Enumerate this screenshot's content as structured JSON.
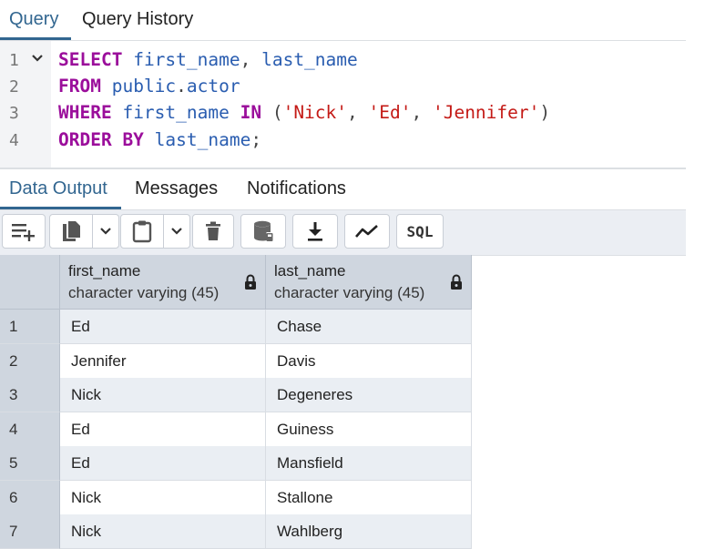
{
  "top_tabs": [
    {
      "label": "Query",
      "active": true
    },
    {
      "label": "Query History",
      "active": false
    }
  ],
  "editor": {
    "line_numbers": [
      "1",
      "2",
      "3",
      "4"
    ],
    "lines": [
      [
        {
          "t": "kw",
          "v": "SELECT"
        },
        {
          "t": "plain",
          "v": " "
        },
        {
          "t": "id",
          "v": "first_name"
        },
        {
          "t": "plain",
          "v": ", "
        },
        {
          "t": "id",
          "v": "last_name"
        }
      ],
      [
        {
          "t": "kw",
          "v": "FROM"
        },
        {
          "t": "plain",
          "v": " "
        },
        {
          "t": "id",
          "v": "public"
        },
        {
          "t": "plain",
          "v": "."
        },
        {
          "t": "id",
          "v": "actor"
        }
      ],
      [
        {
          "t": "kw",
          "v": "WHERE"
        },
        {
          "t": "plain",
          "v": " "
        },
        {
          "t": "id",
          "v": "first_name"
        },
        {
          "t": "plain",
          "v": " "
        },
        {
          "t": "kw",
          "v": "IN"
        },
        {
          "t": "plain",
          "v": " ("
        },
        {
          "t": "str",
          "v": "'Nick'"
        },
        {
          "t": "plain",
          "v": ", "
        },
        {
          "t": "str",
          "v": "'Ed'"
        },
        {
          "t": "plain",
          "v": ", "
        },
        {
          "t": "str",
          "v": "'Jennifer'"
        },
        {
          "t": "plain",
          "v": ")"
        }
      ],
      [
        {
          "t": "kw",
          "v": "ORDER BY"
        },
        {
          "t": "plain",
          "v": " "
        },
        {
          "t": "id",
          "v": "last_name"
        },
        {
          "t": "plain",
          "v": ";"
        }
      ]
    ]
  },
  "output_tabs": [
    {
      "label": "Data Output",
      "active": true
    },
    {
      "label": "Messages",
      "active": false
    },
    {
      "label": "Notifications",
      "active": false
    }
  ],
  "toolbar": {
    "sql_label": "SQL",
    "icons": [
      "add-row-icon",
      "copy-icon",
      "chevron-down-icon",
      "paste-icon",
      "chevron-down-icon",
      "delete-icon",
      "save-data-icon",
      "download-icon",
      "graph-icon",
      "sql-icon"
    ]
  },
  "grid": {
    "columns": [
      {
        "name": "first_name",
        "type": "character varying (45)"
      },
      {
        "name": "last_name",
        "type": "character varying (45)"
      }
    ],
    "rows": [
      [
        "1",
        "Ed",
        "Chase"
      ],
      [
        "2",
        "Jennifer",
        "Davis"
      ],
      [
        "3",
        "Nick",
        "Degeneres"
      ],
      [
        "4",
        "Ed",
        "Guiness"
      ],
      [
        "5",
        "Ed",
        "Mansfield"
      ],
      [
        "6",
        "Nick",
        "Stallone"
      ],
      [
        "7",
        "Nick",
        "Wahlberg"
      ]
    ]
  },
  "colors": {
    "accent": "#326690",
    "keyword": "#9b0e9b",
    "identifier": "#2a5db0",
    "string": "#c41a16"
  }
}
